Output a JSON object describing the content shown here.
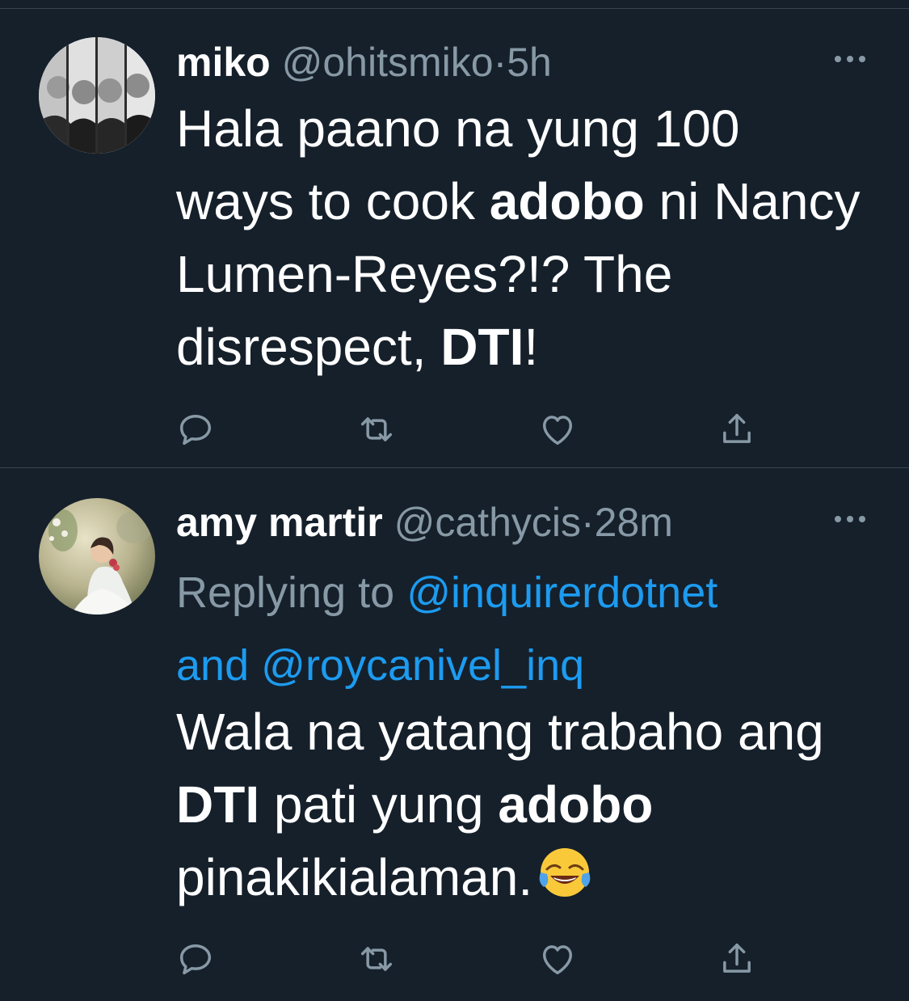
{
  "tweets": [
    {
      "name": "miko",
      "handle": "@ohitsmiko",
      "separator": "·",
      "time": "5h",
      "text_parts": [
        {
          "t": "Hala paano na yung 100 ways to cook ",
          "bold": false
        },
        {
          "t": "adobo",
          "bold": true
        },
        {
          "t": " ni Nancy Lumen-Reyes?!? The disrespect, ",
          "bold": false
        },
        {
          "t": "DTI",
          "bold": true
        },
        {
          "t": "!",
          "bold": false
        }
      ]
    },
    {
      "name": "amy martir",
      "handle": "@cathycis",
      "separator": "·",
      "time": "28m",
      "replying_label": "Replying to",
      "replying_mention_1": "@inquirerdotnet",
      "replying_and": "and",
      "replying_mention_2": "@roycanivel_inq",
      "text_parts": [
        {
          "t": "Wala na yatang trabaho ang ",
          "bold": false
        },
        {
          "t": "DTI",
          "bold": true
        },
        {
          "t": " pati yung ",
          "bold": false
        },
        {
          "t": "adobo",
          "bold": true
        },
        {
          "t": " pinakikialaman.",
          "bold": false
        }
      ],
      "emoji": "face-with-tears-of-joy"
    }
  ],
  "icons": {
    "more": "more-horizontal-icon",
    "reply": "reply-icon",
    "retweet": "retweet-icon",
    "like": "heart-icon",
    "share": "share-icon"
  },
  "colors": {
    "background": "#15202b",
    "divider": "#38444d",
    "text_primary": "#ffffff",
    "text_secondary": "#8899a6",
    "link": "#1d9bf0"
  }
}
